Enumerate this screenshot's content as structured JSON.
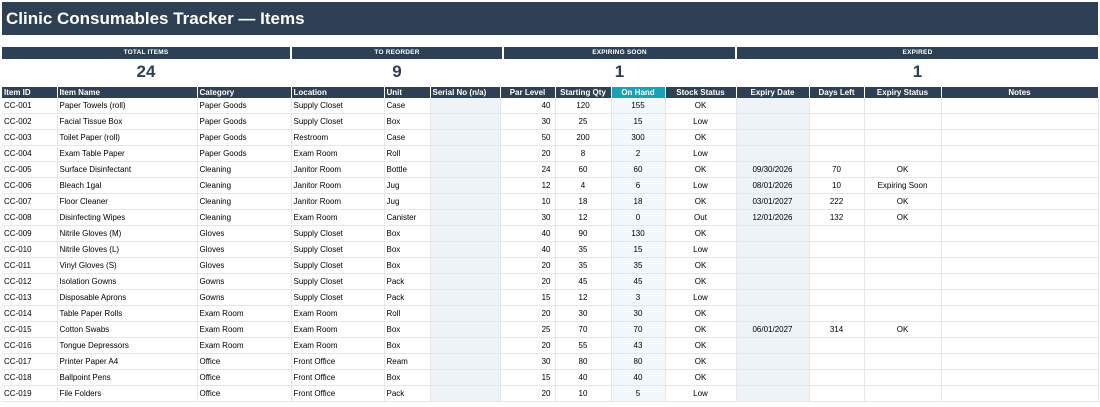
{
  "title": "Clinic Consumables Tracker — Items",
  "kpis": [
    {
      "label": "TOTAL ITEMS",
      "value": "24"
    },
    {
      "label": "TO REORDER",
      "value": "9"
    },
    {
      "label": "EXPIRING SOON",
      "value": "1"
    },
    {
      "label": "EXPIRED",
      "value": "1"
    }
  ],
  "columns": [
    "Item ID",
    "Item Name",
    "Category",
    "Location",
    "Unit",
    "Serial No (n/a)",
    "Par Level",
    "Starting Qty",
    "On Hand",
    "Stock Status",
    "Expiry Date",
    "Days Left",
    "Expiry Status",
    "Notes"
  ],
  "rows": [
    [
      "CC-001",
      "Paper Towels (roll)",
      "Paper Goods",
      "Supply Closet",
      "Case",
      "",
      "40",
      "120",
      "155",
      "OK",
      "",
      "",
      "",
      ""
    ],
    [
      "CC-002",
      "Facial Tissue Box",
      "Paper Goods",
      "Supply Closet",
      "Box",
      "",
      "30",
      "25",
      "15",
      "Low",
      "",
      "",
      "",
      ""
    ],
    [
      "CC-003",
      "Toilet Paper (roll)",
      "Paper Goods",
      "Restroom",
      "Case",
      "",
      "50",
      "200",
      "300",
      "OK",
      "",
      "",
      "",
      ""
    ],
    [
      "CC-004",
      "Exam Table Paper",
      "Paper Goods",
      "Exam Room",
      "Roll",
      "",
      "20",
      "8",
      "2",
      "Low",
      "",
      "",
      "",
      ""
    ],
    [
      "CC-005",
      "Surface Disinfectant",
      "Cleaning",
      "Janitor Room",
      "Bottle",
      "",
      "24",
      "60",
      "60",
      "OK",
      "09/30/2026",
      "70",
      "OK",
      ""
    ],
    [
      "CC-006",
      "Bleach 1gal",
      "Cleaning",
      "Janitor Room",
      "Jug",
      "",
      "12",
      "4",
      "6",
      "Low",
      "08/01/2026",
      "10",
      "Expiring Soon",
      ""
    ],
    [
      "CC-007",
      "Floor Cleaner",
      "Cleaning",
      "Janitor Room",
      "Jug",
      "",
      "10",
      "18",
      "18",
      "OK",
      "03/01/2027",
      "222",
      "OK",
      ""
    ],
    [
      "CC-008",
      "Disinfecting Wipes",
      "Cleaning",
      "Exam Room",
      "Canister",
      "",
      "30",
      "12",
      "0",
      "Out",
      "12/01/2026",
      "132",
      "OK",
      ""
    ],
    [
      "CC-009",
      "Nitrile Gloves (M)",
      "Gloves",
      "Supply Closet",
      "Box",
      "",
      "40",
      "90",
      "130",
      "OK",
      "",
      "",
      "",
      ""
    ],
    [
      "CC-010",
      "Nitrile Gloves (L)",
      "Gloves",
      "Supply Closet",
      "Box",
      "",
      "40",
      "35",
      "15",
      "Low",
      "",
      "",
      "",
      ""
    ],
    [
      "CC-011",
      "Vinyl Gloves (S)",
      "Gloves",
      "Supply Closet",
      "Box",
      "",
      "20",
      "35",
      "35",
      "OK",
      "",
      "",
      "",
      ""
    ],
    [
      "CC-012",
      "Isolation Gowns",
      "Gowns",
      "Supply Closet",
      "Pack",
      "",
      "20",
      "45",
      "45",
      "OK",
      "",
      "",
      "",
      ""
    ],
    [
      "CC-013",
      "Disposable Aprons",
      "Gowns",
      "Supply Closet",
      "Pack",
      "",
      "15",
      "12",
      "3",
      "Low",
      "",
      "",
      "",
      ""
    ],
    [
      "CC-014",
      "Table Paper Rolls",
      "Exam Room",
      "Exam Room",
      "Roll",
      "",
      "20",
      "30",
      "30",
      "OK",
      "",
      "",
      "",
      ""
    ],
    [
      "CC-015",
      "Cotton Swabs",
      "Exam Room",
      "Exam Room",
      "Box",
      "",
      "25",
      "70",
      "70",
      "OK",
      "06/01/2027",
      "314",
      "OK",
      ""
    ],
    [
      "CC-016",
      "Tongue Depressors",
      "Exam Room",
      "Exam Room",
      "Box",
      "",
      "20",
      "55",
      "43",
      "OK",
      "",
      "",
      "",
      ""
    ],
    [
      "CC-017",
      "Printer Paper A4",
      "Office",
      "Front Office",
      "Ream",
      "",
      "30",
      "80",
      "80",
      "OK",
      "",
      "",
      "",
      ""
    ],
    [
      "CC-018",
      "Ballpoint Pens",
      "Office",
      "Front Office",
      "Box",
      "",
      "15",
      "40",
      "40",
      "OK",
      "",
      "",
      "",
      ""
    ],
    [
      "CC-019",
      "File Folders",
      "Office",
      "Front Office",
      "Pack",
      "",
      "20",
      "10",
      "5",
      "Low",
      "",
      "",
      "",
      ""
    ]
  ],
  "colors": {
    "header": "#2e4053",
    "on_hand_header": "#17a2b8",
    "shade": "#eef3f8"
  }
}
